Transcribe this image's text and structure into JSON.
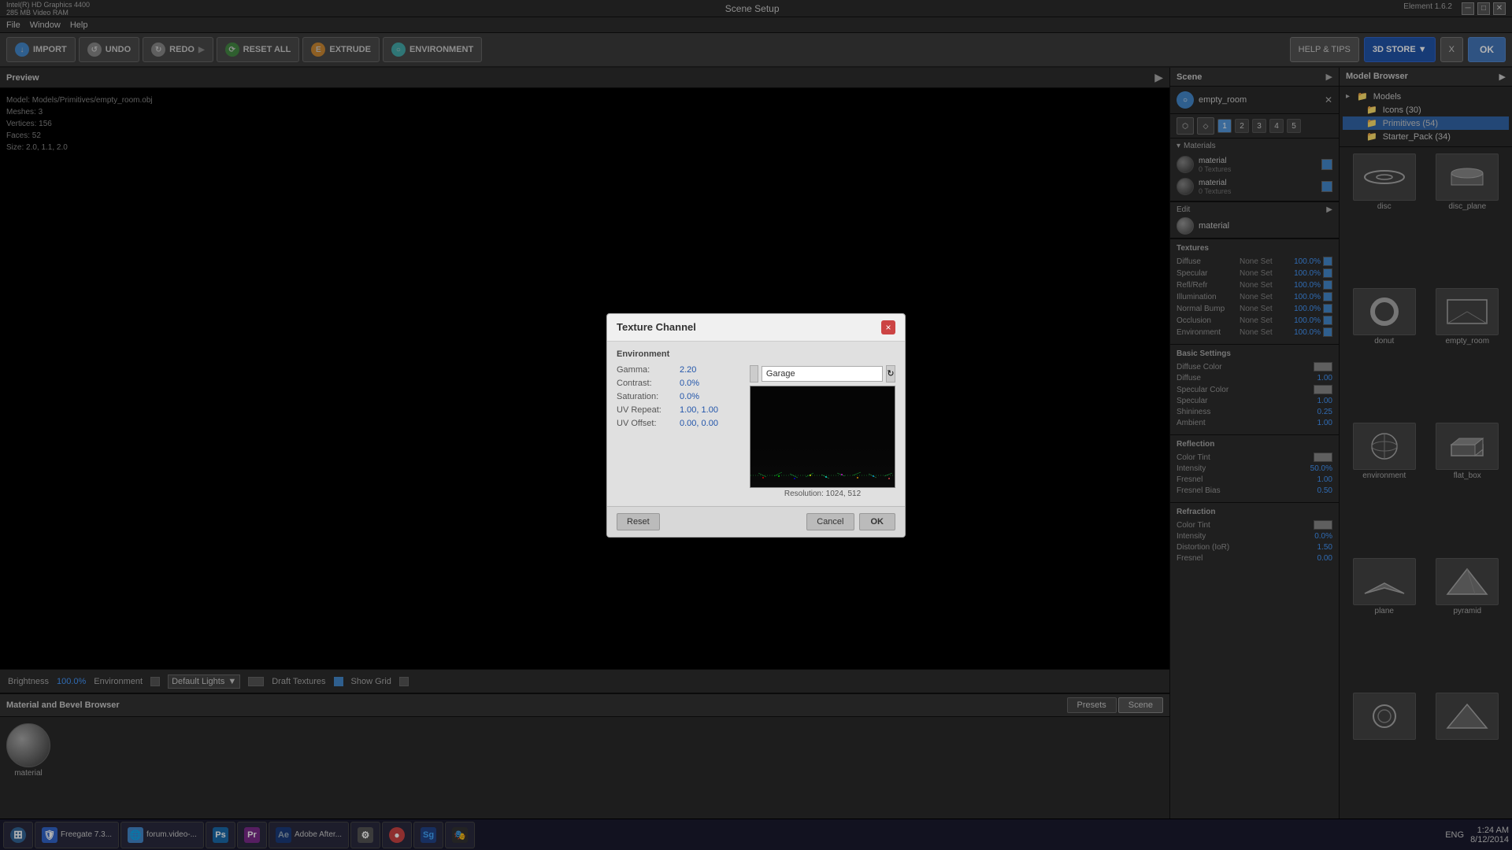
{
  "window": {
    "title": "Scene Setup",
    "info": "Intel(R) HD Graphics 4400\n285 MB Video RAM",
    "app": "Element  1.6.2"
  },
  "menu": {
    "items": [
      "File",
      "Window",
      "Help"
    ]
  },
  "toolbar": {
    "import": "IMPORT",
    "undo": "UNDO",
    "redo": "REDO",
    "reset_all": "RESET ALL",
    "extrude": "EXTRUDE",
    "environment": "ENVIRONMENT",
    "help_tips": "HELP & TIPS",
    "store": "3D STORE",
    "x_label": "X",
    "ok_label": "OK"
  },
  "preview": {
    "title": "Preview",
    "model_info": "Model: Models/Primitives/empty_room.obj",
    "meshes": "Meshes: 3",
    "vertices": "Vertices: 156",
    "faces": "Faces: 52",
    "size": "Size: 2.0, 1.1, 2.0"
  },
  "status_bar": {
    "brightness_label": "Brightness",
    "brightness_val": "100.0%",
    "environment_label": "Environment",
    "lights_label": "Default Lights",
    "draft_textures_label": "Draft Textures",
    "show_grid_label": "Show Grid"
  },
  "scene": {
    "title": "Scene",
    "room_name": "empty_room",
    "tabs": [
      "1",
      "2",
      "3",
      "4",
      "5"
    ],
    "materials_title": "Materials",
    "materials": [
      {
        "name": "material",
        "textures": "0 Textures"
      },
      {
        "name": "material",
        "textures": "0 Textures"
      }
    ],
    "edit_title": "Edit",
    "edit_material": "material"
  },
  "textures": {
    "title": "Textures",
    "rows": [
      {
        "name": "Diffuse",
        "val": "None Set",
        "pct": "100.0%"
      },
      {
        "name": "Specular",
        "val": "None Set",
        "pct": "100.0%"
      },
      {
        "name": "Refl/Refr",
        "val": "None Set",
        "pct": "100.0%"
      },
      {
        "name": "Illumination",
        "val": "None Set",
        "pct": "100.0%"
      },
      {
        "name": "Normal Bump",
        "val": "None Set",
        "pct": "100.0%"
      },
      {
        "name": "Occlusion",
        "val": "None Set",
        "pct": "100.0%"
      },
      {
        "name": "Environment",
        "val": "None Set",
        "pct": "100.0%"
      }
    ]
  },
  "basic_settings": {
    "title": "Basic Settings",
    "rows": [
      {
        "name": "Diffuse Color",
        "has_swatch": true,
        "val": ""
      },
      {
        "name": "Diffuse",
        "val": "1.00"
      },
      {
        "name": "Specular Color",
        "has_swatch": true,
        "val": ""
      },
      {
        "name": "Specular",
        "val": "1.00"
      },
      {
        "name": "Shininess",
        "val": "0.25"
      },
      {
        "name": "Ambient",
        "val": "1.00"
      }
    ]
  },
  "reflection": {
    "title": "Reflection",
    "rows": [
      {
        "name": "Color Tint",
        "has_swatch": true,
        "val": ""
      },
      {
        "name": "Intensity",
        "val": "50.0%"
      },
      {
        "name": "Fresnel",
        "val": "1.00"
      },
      {
        "name": "Fresnel Bias",
        "val": "0.50"
      }
    ]
  },
  "refraction": {
    "title": "Refraction",
    "rows": [
      {
        "name": "Color Tint",
        "has_swatch": true,
        "val": ""
      },
      {
        "name": "Intensity",
        "val": "0.0%"
      },
      {
        "name": "Distortion (IoR)",
        "val": "1.50"
      },
      {
        "name": "Fresnel",
        "val": "0.00"
      }
    ]
  },
  "model_browser": {
    "title": "Model Browser",
    "tree": [
      {
        "label": "Models",
        "indent": 0,
        "arrow": "▸"
      },
      {
        "label": "Icons (30)",
        "indent": 1,
        "arrow": ""
      },
      {
        "label": "Primitives (54)",
        "indent": 1,
        "arrow": "",
        "selected": true
      },
      {
        "label": "Starter_Pack (34)",
        "indent": 1,
        "arrow": ""
      }
    ],
    "thumbnails": [
      {
        "label": "disc"
      },
      {
        "label": "disc_plane"
      },
      {
        "label": "donut"
      },
      {
        "label": "empty_room"
      },
      {
        "label": "environment"
      },
      {
        "label": "flat_box"
      },
      {
        "label": "plane"
      },
      {
        "label": "pyramid"
      }
    ]
  },
  "bottom_panel": {
    "title": "Material and Bevel Browser",
    "tabs": [
      "Presets",
      "Scene"
    ],
    "active_tab": "Presets",
    "sphere_label": "material"
  },
  "dialog": {
    "title": "Texture Channel",
    "section": "Environment",
    "close_btn": "×",
    "gamma_label": "Gamma:",
    "gamma_val": "2.20",
    "contrast_label": "Contrast:",
    "contrast_val": "0.0%",
    "saturation_label": "Saturation:",
    "saturation_val": "0.0%",
    "uv_repeat_label": "UV Repeat:",
    "uv_repeat_val": "1.00, 1.00",
    "uv_offset_label": "UV Offset:",
    "uv_offset_val": "0.00, 0.00",
    "texture_name": "Garage",
    "resolution": "Resolution: 1024, 512",
    "reset_btn": "Reset",
    "cancel_btn": "Cancel",
    "ok_btn": "OK"
  },
  "taskbar": {
    "items": [
      {
        "label": "Freegate 7.3...",
        "icon": "🛡",
        "color": "#3366cc"
      },
      {
        "label": "forum.video-...",
        "icon": "🌐",
        "color": "#4488cc"
      },
      {
        "label": "",
        "icon": "Ps",
        "color": "#1a6bab"
      },
      {
        "label": "",
        "icon": "Pr",
        "color": "#7c2b8b"
      },
      {
        "label": "Adobe After...",
        "icon": "Ae",
        "color": "#1a3b7c"
      },
      {
        "label": "",
        "icon": "⚙",
        "color": "#555"
      },
      {
        "label": "",
        "icon": "●",
        "color": "#cc4444"
      },
      {
        "label": "",
        "icon": "Sg",
        "color": "#224488"
      },
      {
        "label": "",
        "icon": "🎭",
        "color": "#333"
      }
    ],
    "time": "1:24 AM",
    "date": "8/12/2014",
    "lang": "ENG"
  }
}
